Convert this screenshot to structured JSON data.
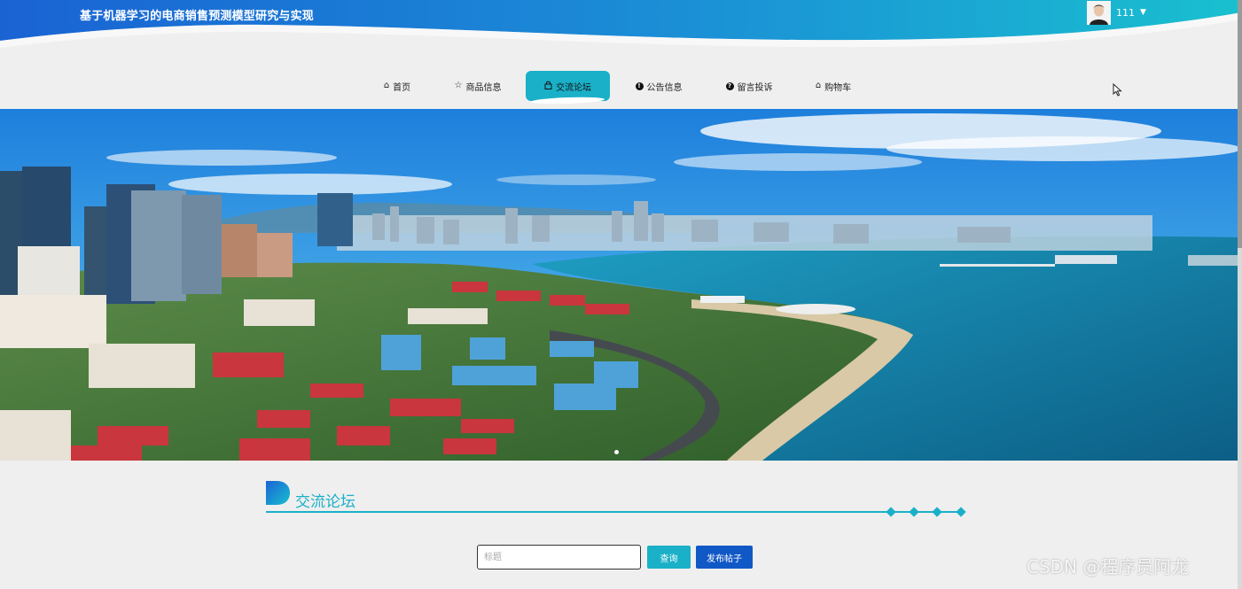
{
  "header": {
    "site_title": "基于机器学习的电商销售预测模型研究与实现",
    "username": "111",
    "caret": "▼"
  },
  "nav": [
    {
      "label": "首页",
      "icon": "home-icon"
    },
    {
      "label": "商品信息",
      "icon": "star-icon"
    },
    {
      "label": "交流论坛",
      "icon": "lock-icon",
      "active": true
    },
    {
      "label": "公告信息",
      "icon": "exclamation-icon"
    },
    {
      "label": "留言投诉",
      "icon": "question-icon"
    },
    {
      "label": "购物车",
      "icon": "home-icon"
    }
  ],
  "section": {
    "title": "交流论坛"
  },
  "search": {
    "placeholder": "标题",
    "query_label": "查询",
    "post_label": "发布帖子"
  },
  "watermark": "CSDN @程序员阿龙",
  "colors": {
    "accent": "#1ab0c8",
    "primary_button": "#1158c7",
    "header_gradient_start": "#1a63d4",
    "header_gradient_end": "#19c0cf"
  }
}
